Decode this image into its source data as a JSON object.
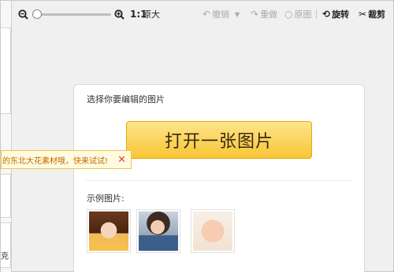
{
  "toolbar": {
    "zoom_out_icon": "zoom-out-icon",
    "zoom_in_icon": "zoom-in-icon",
    "zoom_slider_value": 0,
    "ratio_label": "1:1",
    "original_size_label": "原大",
    "undo_label": "撤销",
    "redo_label": "重做",
    "original_label": "原图",
    "rotate_label": "旋转",
    "crop_label": "裁剪"
  },
  "card": {
    "title": "选择你要编辑的图片",
    "open_button_label": "打开一张图片",
    "sample_label": "示例图片:"
  },
  "tooltip": {
    "text": "的东北大花素材哦，快来试试!",
    "close_icon": "close-icon"
  },
  "sidebar": {
    "partial_text": "克"
  }
}
